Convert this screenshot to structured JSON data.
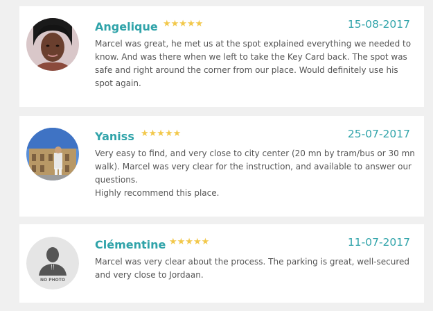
{
  "reviews": [
    {
      "name": "Angelique",
      "stars": "★★★★★",
      "rating": 5,
      "date": "15-08-2017",
      "text": "Marcel was great, he met us at the spot explained everything we needed to know. And was there when we left to take the Key Card back. The spot was safe and right around the corner from our place. Would definitely use his spot again.",
      "avatar": "photo"
    },
    {
      "name": "Yaniss",
      "stars": "★★★★★",
      "rating": 5,
      "date": "25-07-2017",
      "text": "Very easy to find, and very close to city center (20 mn by tram/bus or 30 mn walk). Marcel was very clear for the instruction, and available to answer our questions.",
      "text2": "Highly recommend this place.",
      "avatar": "photo"
    },
    {
      "name": "Clémentine",
      "stars": "★★★★★",
      "rating": 5,
      "date": "11-07-2017",
      "text": "Marcel was very clear about the process. The parking is great, well-secured and very close to Jordaan.",
      "avatar": "no-photo",
      "avatar_label": "NO PHOTO"
    }
  ],
  "colors": {
    "accent": "#2fa3a9",
    "star": "#f2c84b",
    "text": "#555555",
    "background": "#f0f0f0",
    "card": "#ffffff"
  }
}
